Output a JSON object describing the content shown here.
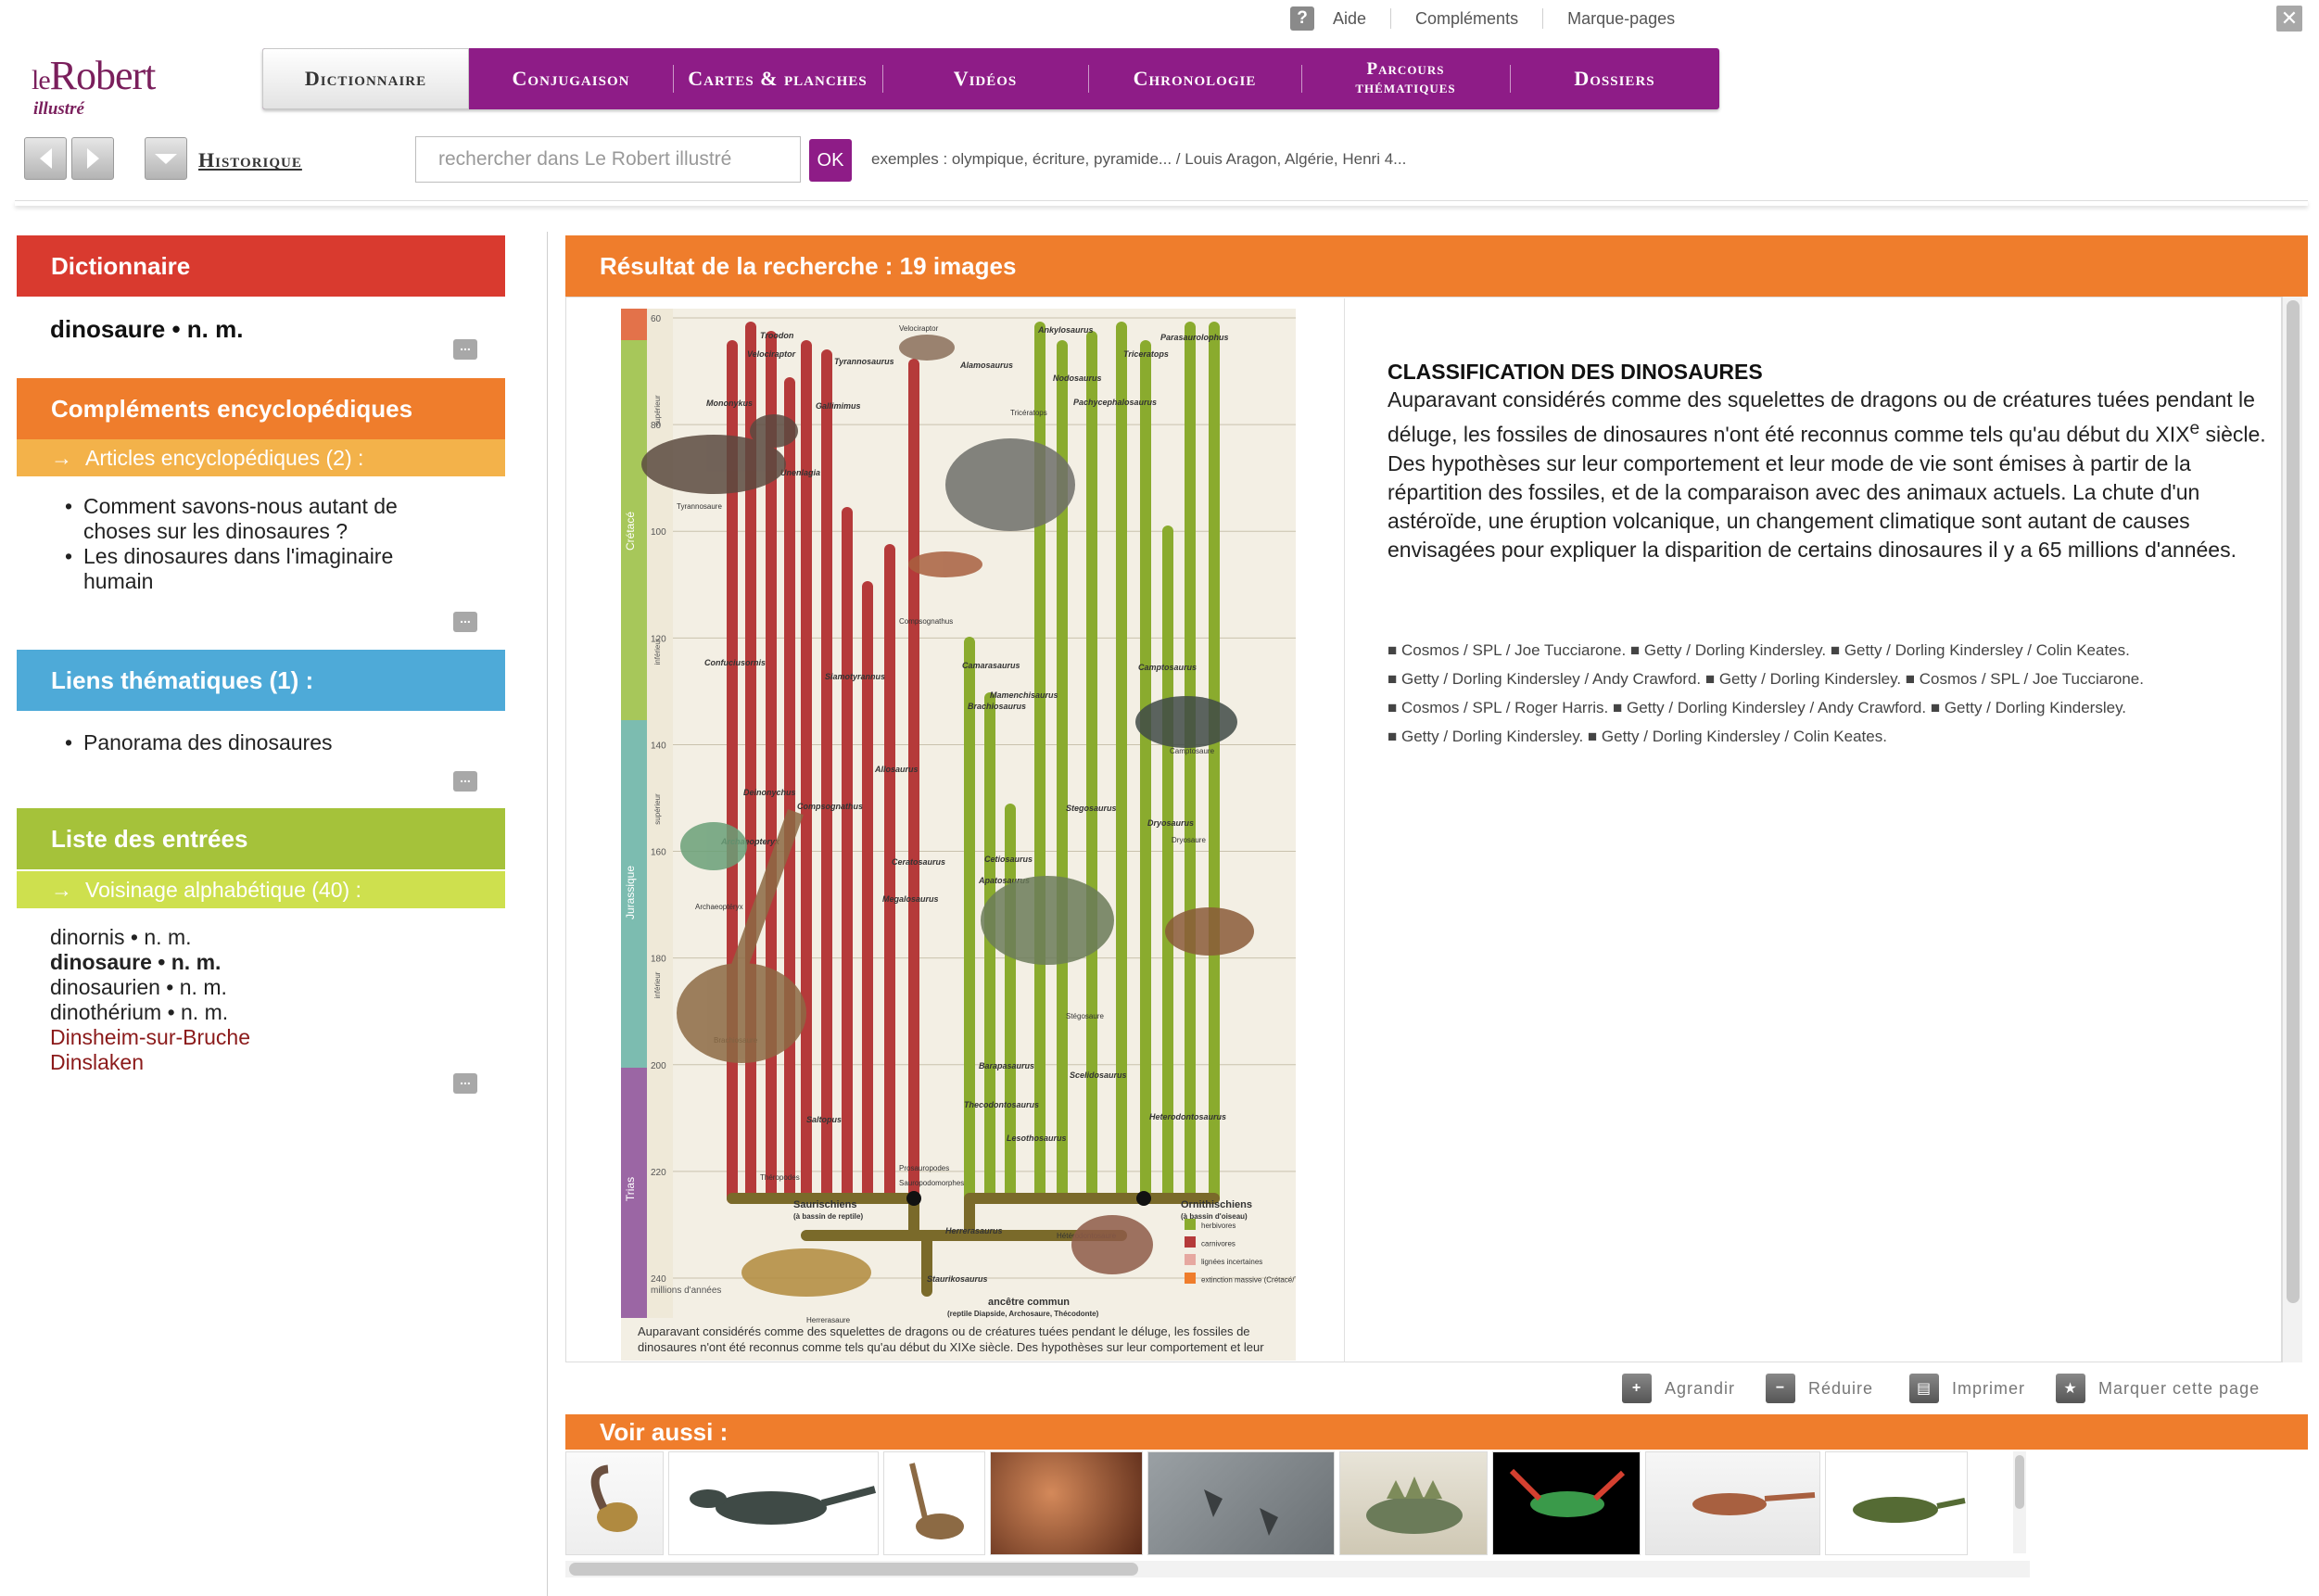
{
  "topbar": {
    "help_icon": "?",
    "links": [
      "Aide",
      "Compléments",
      "Marque-pages"
    ],
    "close_icon": "close-icon"
  },
  "logo": {
    "le": "le",
    "robert": "Robert",
    "illustre": "illustré"
  },
  "nav": {
    "tabs": [
      "Dictionnaire",
      "Conjugaison",
      "Cartes & planches",
      "Vidéos",
      "Chronologie",
      "Parcours",
      "thématiques",
      "Dossiers"
    ],
    "historique": "Historique"
  },
  "search": {
    "placeholder": "rechercher dans Le Robert illustré",
    "ok": "OK",
    "examples": "exemples : olympique, écriture, pyramide... / Louis Aragon, Algérie, Henri 4..."
  },
  "left": {
    "dictionnaire": {
      "title": "Dictionnaire",
      "entry": "dinosaure • n. m."
    },
    "complements": {
      "title": "Compléments encyclopédiques",
      "sub": "Articles encyclopédiques (2) :",
      "items": [
        "Comment savons-nous autant de",
        "choses sur les dinosaures ?",
        "Les dinosaures dans l'imaginaire",
        "humain"
      ]
    },
    "liens": {
      "title": "Liens thématiques (1) :",
      "items": [
        "Panorama des dinosaures"
      ]
    },
    "liste": {
      "title": "Liste des entrées",
      "sub": "Voisinage alphabétique (40) :",
      "entries": [
        "dinornis • n. m.",
        "dinosaure • n. m.",
        "dinosaurien • n. m.",
        "dinothérium • n. m.",
        "Dinsheim-sur-Bruche",
        "Dinslaken"
      ]
    },
    "more": "..."
  },
  "result": {
    "title": "Résultat de la recherche : 19 images",
    "poster_caption": "Auparavant considérés comme des squelettes de dragons ou de créatures tuées pendant le déluge, les fossiles de dinosaures n'ont été reconnus comme tels qu'au début du XIXe siècle. Des hypothèses sur leur comportement et leur",
    "desc_title": "CLASSIFICATION DES DINOSAURES",
    "desc_p1": "Auparavant considérés comme des squelettes de dragons ou de créatures tuées pendant le déluge, les fossiles de dinosaures n'ont été reconnus comme tels qu'au début du XIX",
    "desc_sup": "e",
    "desc_p2": " siècle. Des hypothèses sur leur comportement et leur mode de vie sont émises à partir de la répartition des fossiles, et de la comparaison avec des animaux actuels. La chute d'un astéroïde, une éruption volcanique, un changement climatique sont autant de causes envisagées pour expliquer la disparition de certains dinosaures il y a 65 millions d'années.",
    "credits": [
      "■  Cosmos / SPL / Joe Tucciarone. ■ Getty / Dorling Kindersley. ■ Getty / Dorling Kindersley / Colin Keates.",
      "■ Getty / Dorling Kindersley / Andy Crawford. ■ Getty / Dorling Kindersley. ■ Cosmos / SPL / Joe Tucciarone.",
      "■ Cosmos / SPL / Roger Harris. ■ Getty / Dorling Kindersley / Andy Crawford. ■ Getty / Dorling Kindersley.",
      "■ Getty / Dorling Kindersley. ■ Getty / Dorling Kindersley / Colin Keates."
    ]
  },
  "tools": {
    "agrandir": "Agrandir",
    "reduire": "Réduire",
    "imprimer": "Imprimer",
    "marquer": "Marquer cette page"
  },
  "voir": {
    "title": "Voir aussi :"
  },
  "poster": {
    "periods": [
      "Crétacé",
      "Jurassique",
      "Trias"
    ],
    "subperiods": [
      "supérieur",
      "inférieur",
      "supérieur",
      "inférieur"
    ],
    "ages": [
      "60",
      "80",
      "100",
      "120",
      "140",
      "160",
      "180",
      "200",
      "220",
      "240"
    ],
    "age_unit": "millions d'années",
    "saurischiens": "Saurischiens",
    "saurischiens_sub": "(à bassin de reptile)",
    "ornithischiens": "Ornithischiens",
    "ornithischiens_sub": "(à bassin d'oiseau)",
    "ancestor": "ancêtre commun",
    "ancestor_sub": "(reptile Diapside, Archosaure, Thécodonte)",
    "legend": [
      "herbivores",
      "carnivores",
      "lignées incertaines",
      "extinction massive (Crétacé/Tertiaire)"
    ],
    "species_left": [
      "Troodon",
      "Velociraptor",
      "Tyrannosaurus",
      "Mononykus",
      "Gallimimus",
      "Unenlagia",
      "Confuciusornis",
      "Siamotyrannus",
      "Deinonychus",
      "Compsognathus",
      "Allosaurus",
      "Archaeopteryx",
      "Ceratosaurus",
      "Megalosaurus",
      "Saltopus",
      "Herrerasaurus",
      "Staurikosaurus"
    ],
    "species_right": [
      "Ankylosaurus",
      "Alamosaurus",
      "Triceratops",
      "Parasaurolophus",
      "Nodosaurus",
      "Pachycephalosaurus",
      "Camarasaurus",
      "Brachiosaurus",
      "Mamenchisaurus",
      "Camptosaurus",
      "Stegosaurus",
      "Dryosaurus",
      "Cetiosaurus",
      "Apatosaurus",
      "Barapasaurus",
      "Scelidosaurus",
      "Heterodontosaurus",
      "Thecodontosaurus",
      "Lesothosaurus"
    ],
    "small_labels": [
      "Velociraptor",
      "Tyrannosaure",
      "Tricératops",
      "Compsognathus",
      "Camptosaure",
      "Dryosaure",
      "Stégosaure",
      "Archaeoptéryx",
      "Brachiosaure",
      "Herrerasaure",
      "Hétérodontosaure",
      "Théropodes",
      "Prosauropodes",
      "Sauropodomorphes"
    ]
  },
  "colors": {
    "purple": "#8e1c87",
    "red": "#d93a2f",
    "orange": "#ef7d2c",
    "blue": "#4eaad8",
    "green": "#a5c23a",
    "herbivore": "#8aab2e",
    "carnivore": "#b53a3a"
  }
}
